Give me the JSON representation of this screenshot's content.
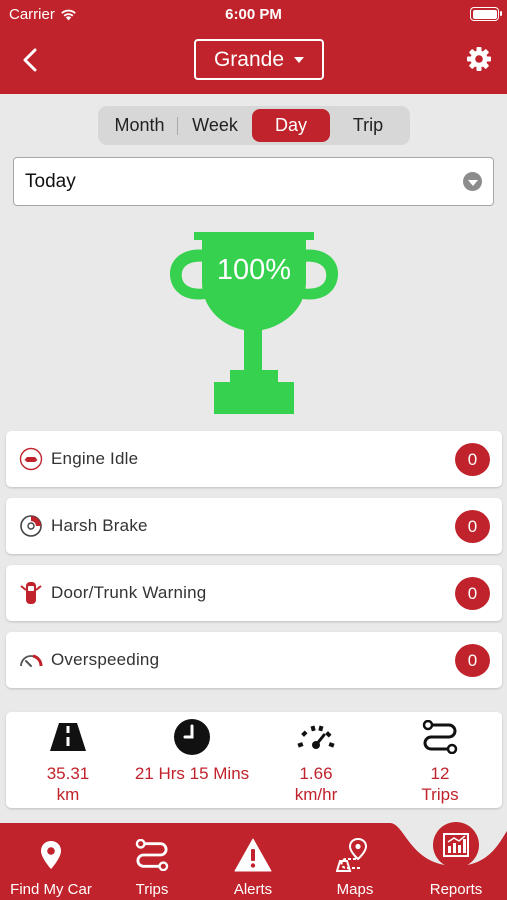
{
  "status_bar": {
    "carrier": "Carrier",
    "time": "6:00 PM"
  },
  "header": {
    "vehicle": "Grande",
    "back_icon": "chevron-left-icon",
    "settings_icon": "gear-icon"
  },
  "period_tabs": [
    {
      "label": "Month",
      "active": false
    },
    {
      "label": "Week",
      "active": false
    },
    {
      "label": "Day",
      "active": true
    },
    {
      "label": "Trip",
      "active": false
    }
  ],
  "date_filter": {
    "value": "Today"
  },
  "score": {
    "value": "100%",
    "icon": "trophy-icon"
  },
  "events": [
    {
      "label": "Engine Idle",
      "count": "0",
      "icon": "engine-icon"
    },
    {
      "label": "Harsh Brake",
      "count": "0",
      "icon": "brake-icon"
    },
    {
      "label": "Door/Trunk Warning",
      "count": "0",
      "icon": "car-door-icon"
    },
    {
      "label": "Overspeeding",
      "count": "0",
      "icon": "speedometer-icon"
    }
  ],
  "stats": [
    {
      "line1": "35.31",
      "line2": "km",
      "icon": "road-icon"
    },
    {
      "line1": "21 Hrs 15 Mins",
      "line2": "",
      "icon": "clock-icon"
    },
    {
      "line1": "1.66",
      "line2": "km/hr",
      "icon": "gauge-icon"
    },
    {
      "line1": "12",
      "line2": "Trips",
      "icon": "route-icon"
    }
  ],
  "tabbar": [
    {
      "label": "Find My Car",
      "icon": "location-pin-icon"
    },
    {
      "label": "Trips",
      "icon": "route-icon"
    },
    {
      "label": "Alerts",
      "icon": "warning-icon"
    },
    {
      "label": "Maps",
      "icon": "map-icon"
    },
    {
      "label": "Reports",
      "icon": "bar-chart-icon",
      "active": true
    }
  ],
  "colors": {
    "brand": "#c0232b",
    "trophy": "#2ecc50",
    "background": "#e9e9e9"
  }
}
